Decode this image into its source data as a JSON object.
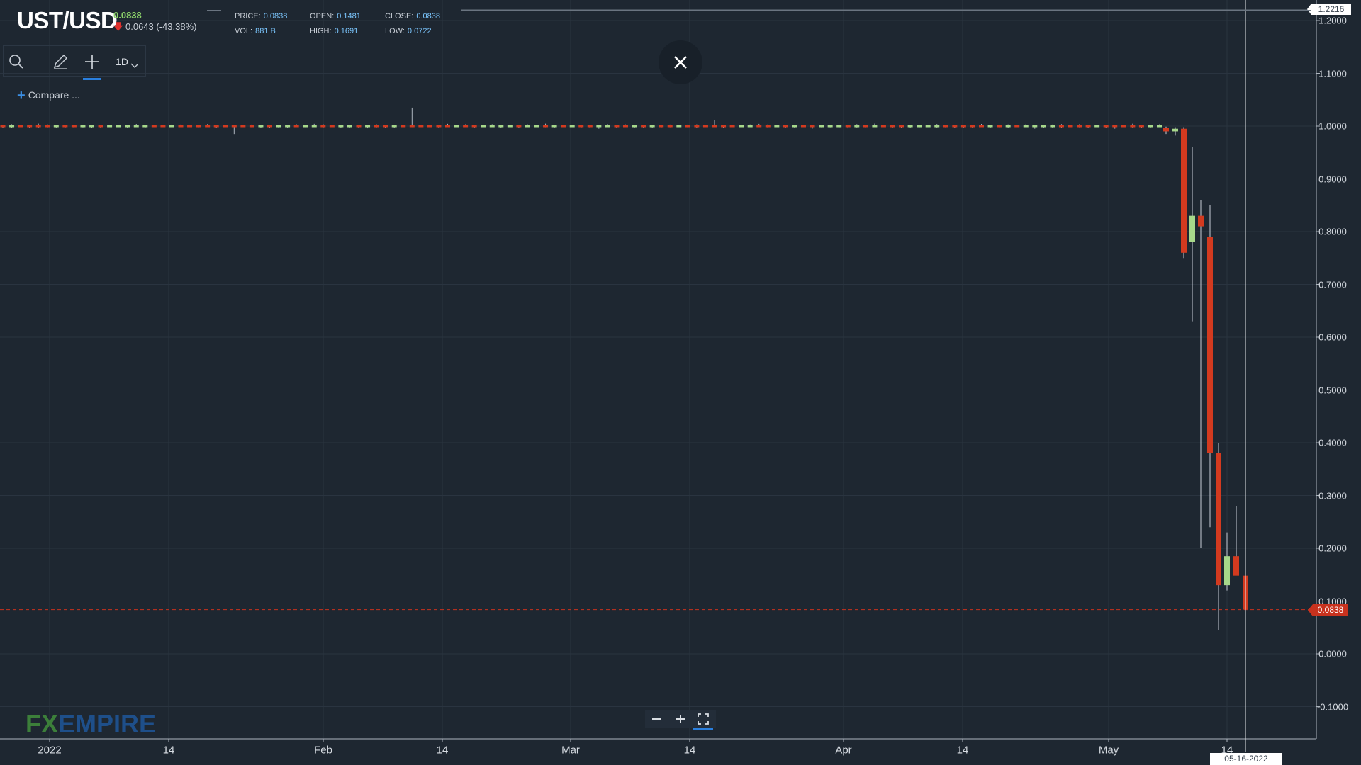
{
  "header": {
    "symbol": "UST/USD",
    "price": "0.0838",
    "change": "0.0643 (-43.38%)",
    "price_label": "PRICE:",
    "price_value": "0.0838",
    "open_label": "OPEN:",
    "open_value": "0.1481",
    "close_label": "CLOSE:",
    "close_value": "0.0838",
    "vol_label": "VOL:",
    "vol_value": "881 B",
    "high_label": "HIGH:",
    "high_value": "0.1691",
    "low_label": "LOW:",
    "low_value": "0.0722"
  },
  "toolbar": {
    "interval": "1D",
    "icons": [
      "search-icon",
      "pencil-icon",
      "crosshair-icon",
      "chevron-down-icon"
    ]
  },
  "compare_label": "Compare ...",
  "brand": {
    "fx": "FX",
    "rest": "EMPIRE"
  },
  "tags": {
    "max_value": "1.2216",
    "last_price": "0.0838",
    "cursor_date": "05-16-2022"
  },
  "colors": {
    "background": "#1e2731",
    "up": "#a7d88a",
    "down": "#d33a1f",
    "accent": "#2a7fde"
  },
  "chart_data": {
    "type": "candlestick",
    "x_tick_labels": [
      "2022",
      "14",
      "Feb",
      "14",
      "Mar",
      "14",
      "Apr",
      "14",
      "May",
      "14"
    ],
    "y_tick_labels": [
      "1.2000",
      "1.1000",
      "1.0000",
      "0.9000",
      "0.8000",
      "0.7000",
      "0.6000",
      "0.5000",
      "0.4000",
      "0.3000",
      "0.2000",
      "0.1000",
      "0.0000",
      "-0.1000"
    ],
    "ylim": [
      -0.1,
      1.2
    ],
    "grid": true,
    "last_price_line": 0.0838,
    "stable_period": {
      "level": 1.0,
      "approx_candles": 131
    },
    "crash_candles": [
      {
        "date": "2022-05-08",
        "open": 0.997,
        "high": 0.999,
        "low": 0.985,
        "close": 0.99
      },
      {
        "date": "2022-05-09",
        "open": 0.99,
        "high": 0.998,
        "low": 0.982,
        "close": 0.995
      },
      {
        "date": "2022-05-10",
        "open": 0.995,
        "high": 0.998,
        "low": 0.75,
        "close": 0.76
      },
      {
        "date": "2022-05-11",
        "open": 0.78,
        "high": 0.96,
        "low": 0.63,
        "close": 0.83
      },
      {
        "date": "2022-05-12",
        "open": 0.83,
        "high": 0.86,
        "low": 0.2,
        "close": 0.81
      },
      {
        "date": "2022-05-13",
        "open": 0.79,
        "high": 0.85,
        "low": 0.24,
        "close": 0.38
      },
      {
        "date": "2022-05-14",
        "open": 0.38,
        "high": 0.4,
        "low": 0.045,
        "close": 0.13
      },
      {
        "date": "2022-05-15",
        "open": 0.13,
        "high": 0.23,
        "low": 0.12,
        "close": 0.185
      },
      {
        "date": "2022-05-16",
        "open": 0.185,
        "high": 0.28,
        "low": 0.15,
        "close": 0.1481
      },
      {
        "date": "2022-05-17",
        "open": 0.1481,
        "high": 0.1691,
        "low": 0.0722,
        "close": 0.0838
      }
    ]
  }
}
